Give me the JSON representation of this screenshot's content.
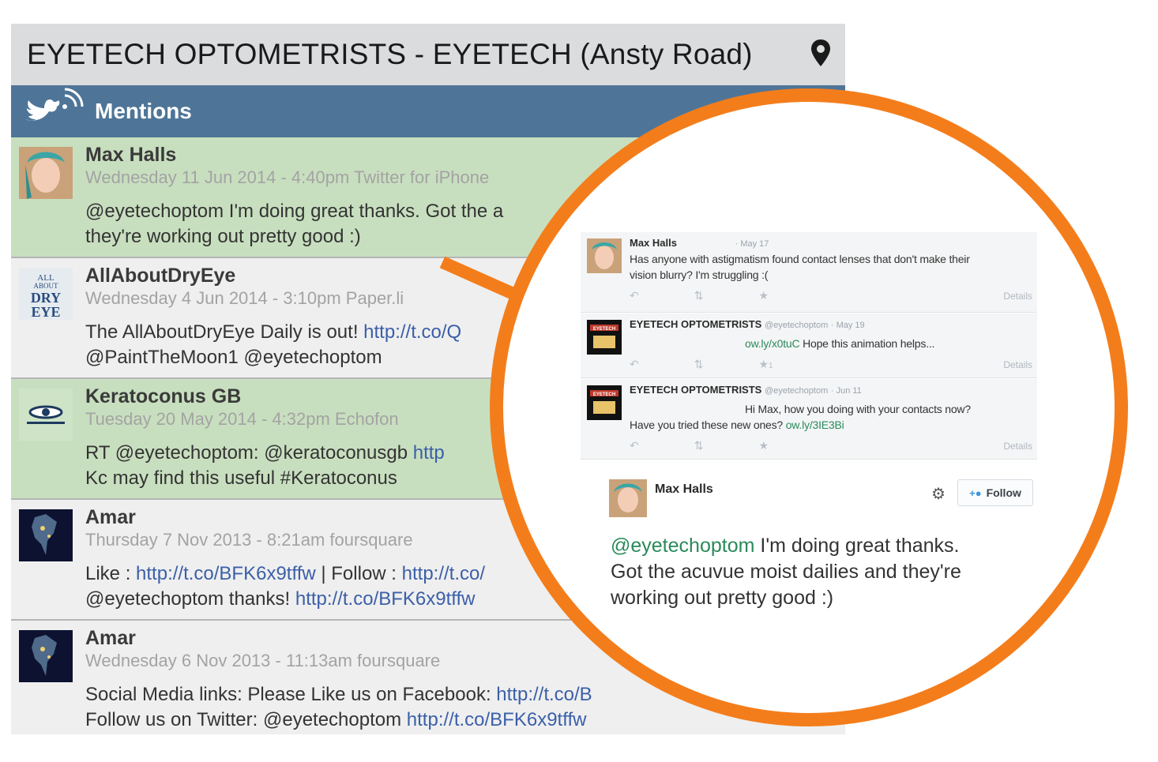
{
  "header": {
    "title": "EYETECH OPTOMETRISTS - EYETECH (Ansty Road)",
    "pin_icon": "location-pin-icon"
  },
  "mentions_bar": {
    "title": "Mentions",
    "icon": "twitter-bird-icon"
  },
  "mentions": [
    {
      "name": "Max Halls",
      "meta": "Wednesday 11 Jun 2014 - 4:40pm Twitter for iPhone",
      "line1": "@eyetechoptom I'm doing great thanks. Got the a",
      "line1_link": "",
      "line2": "they're working out pretty good :)",
      "line2_link": "",
      "line2_after": ""
    },
    {
      "name": "AllAboutDryEye",
      "meta": "Wednesday 4 Jun 2014 - 3:10pm Paper.li",
      "line1": "The AllAboutDryEye Daily is out! ",
      "line1_link": "http://t.co/Q",
      "line2": "@PaintTheMoon1 @eyetechoptom",
      "line2_link": "",
      "line2_after": ""
    },
    {
      "name": "Keratoconus GB",
      "meta": "Tuesday 20 May 2014 - 4:32pm Echofon",
      "line1": "RT @eyetechoptom: @keratoconusgb ",
      "line1_link": "http",
      "line2": "Kc may find this useful #Keratoconus",
      "line2_link": "",
      "line2_after": ""
    },
    {
      "name": "Amar",
      "meta": "Thursday 7 Nov 2013 - 8:21am foursquare",
      "line1": "Like : ",
      "line1_link": "http://t.co/BFK6x9tffw",
      "line1_after": " | Follow : ",
      "line1_link2": "http://t.co/",
      "line2": "@eyetechoptom thanks! ",
      "line2_link": "http://t.co/BFK6x9tffw",
      "line2_after": ""
    },
    {
      "name": "Amar",
      "meta": "Wednesday 6 Nov 2013 - 11:13am foursquare",
      "line1": "Social Media links: Please Like us on Facebook: ",
      "line1_link": "http://t.co/B",
      "line2": "Follow us on Twitter: @eyetechoptom ",
      "line2_link": "http://t.co/BFK6x9tffw",
      "line2_after": ""
    }
  ],
  "zoom": {
    "thread": [
      {
        "name": "Max Halls",
        "handle": "",
        "date": "· May 17",
        "text1": "Has anyone with astigmatism found contact lenses that don't make their",
        "text2": "vision blurry? I'm struggling :(",
        "link": "",
        "fav_count": "",
        "details": "Details"
      },
      {
        "name": "EYETECH OPTOMETRISTS",
        "handle": "@eyetechoptom",
        "date": "· May 19",
        "text1": "",
        "link": "ow.ly/x0tuC",
        "text_after": " Hope this animation helps...",
        "fav_count": "1",
        "details": "Details"
      },
      {
        "name": "EYETECH OPTOMETRISTS",
        "handle": "@eyetechoptom",
        "date": "· Jun 11",
        "text1": "Hi Max, how you doing with your contacts now?",
        "text2": "Have you tried these new ones? ",
        "link": "ow.ly/3IE3Bi",
        "fav_count": "",
        "details": "Details"
      }
    ],
    "card": {
      "name": "Max Halls",
      "follow_label": "Follow",
      "mention": "@eyetechoptom",
      "text_rest1": " I'm doing great thanks.",
      "text_line2": "Got the acuvue moist dailies and they're",
      "text_line3": "working out pretty good :)"
    }
  },
  "colors": {
    "header_bg": "#dadcde",
    "mentions_bar": "#4e7597",
    "highlight_row": "#c8dfbf",
    "plain_row": "#efefef",
    "magnifier_ring": "#f47d1b",
    "link": "#3b5fa8",
    "twitter_link": "#2a8a5a"
  }
}
